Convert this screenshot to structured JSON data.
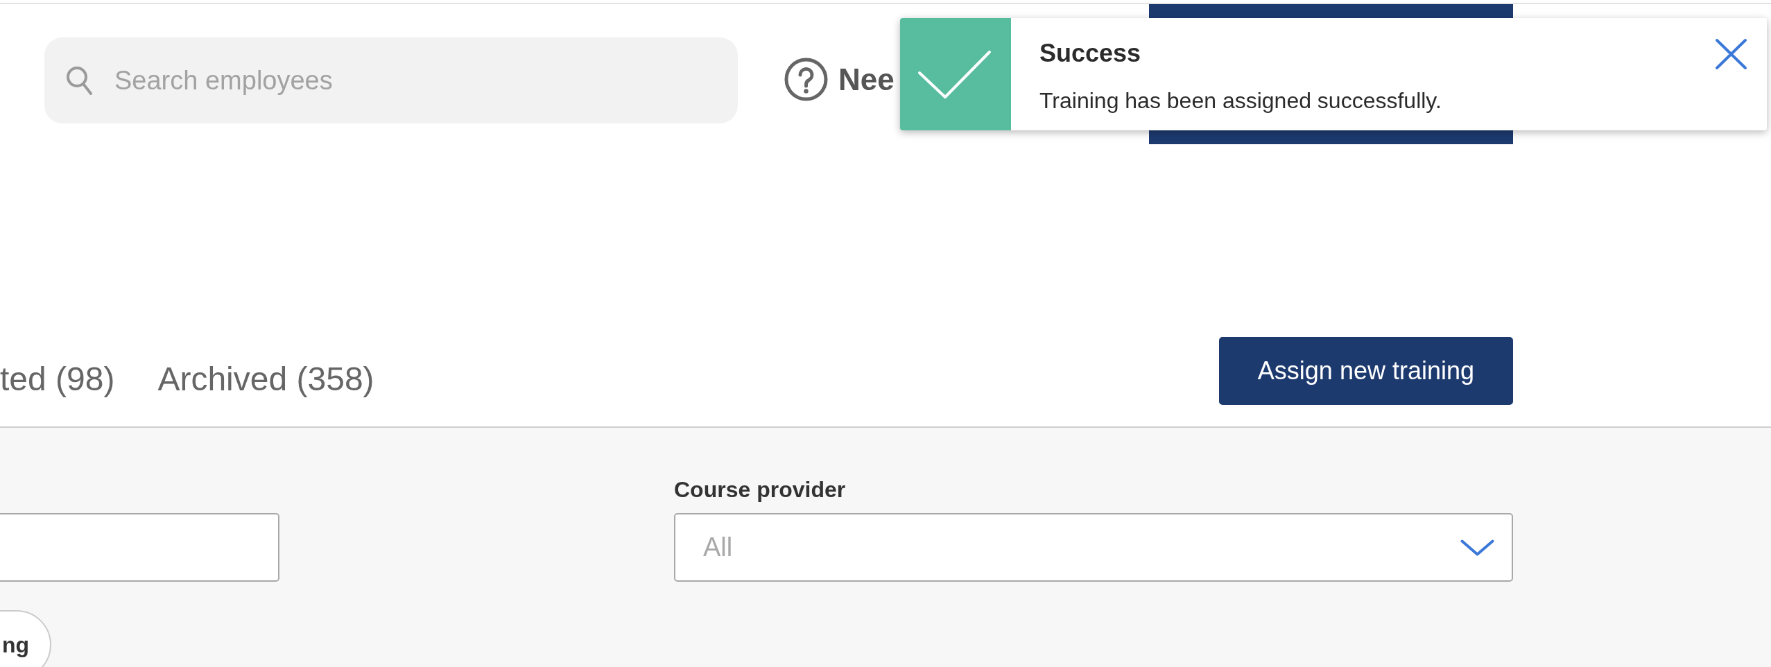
{
  "header": {
    "search": {
      "placeholder": "Search employees"
    },
    "help_link": {
      "label": "Nee"
    }
  },
  "toast": {
    "kind": "success",
    "title": "Success",
    "message": "Training has been assigned successfully."
  },
  "tabs": [
    {
      "label": "ted (98)",
      "selected": false
    },
    {
      "label": "Archived (358)",
      "selected": false
    }
  ],
  "assign_button": {
    "label": "Assign new training"
  },
  "filters": [
    {
      "kind": "text"
    },
    {
      "kind": "select",
      "label": "Course provider",
      "placeholder": "All"
    }
  ],
  "chips": [
    {
      "label": "ng"
    }
  ]
}
